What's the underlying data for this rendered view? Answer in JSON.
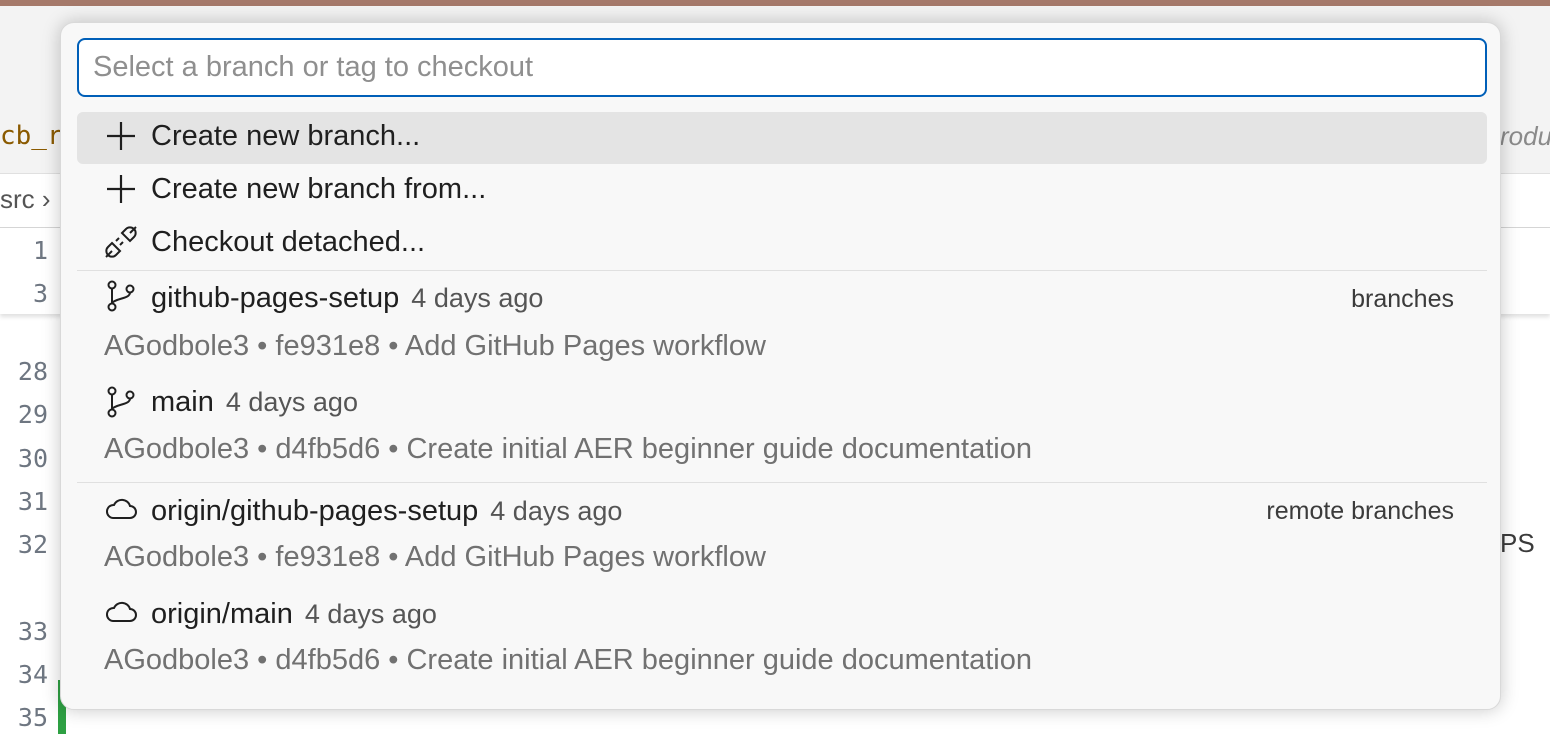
{
  "background": {
    "tab_left": "cb_r",
    "tab_right": "rodu",
    "breadcrumb": "src",
    "sticky_line_numbers": [
      "1",
      "3"
    ],
    "line_numbers": [
      "28",
      "29",
      "30",
      "31",
      "32",
      "33",
      "34",
      "35"
    ],
    "right_text": "PS"
  },
  "quickpick": {
    "placeholder": "Select a branch or tag to checkout",
    "actions": [
      {
        "icon": "plus-icon",
        "label": "Create new branch..."
      },
      {
        "icon": "plus-icon",
        "label": "Create new branch from..."
      },
      {
        "icon": "debug-disconnect-icon",
        "label": "Checkout detached..."
      }
    ],
    "branch_groups": [
      {
        "label": "branches",
        "icon": "git-branch-icon",
        "items": [
          {
            "name": "github-pages-setup",
            "time": "4 days ago",
            "detail": "AGodbole3 • fe931e8 • Add GitHub Pages workflow"
          },
          {
            "name": "main",
            "time": "4 days ago",
            "detail": "AGodbole3 • d4fb5d6 • Create initial AER beginner guide documentation"
          }
        ]
      },
      {
        "label": "remote branches",
        "icon": "cloud-icon",
        "items": [
          {
            "name": "origin/github-pages-setup",
            "time": "4 days ago",
            "detail": "AGodbole3 • fe931e8 • Add GitHub Pages workflow"
          },
          {
            "name": "origin/main",
            "time": "4 days ago",
            "detail": "AGodbole3 • d4fb5d6 • Create initial AER beginner guide documentation"
          }
        ]
      }
    ]
  },
  "colors": {
    "focus_border": "#005fb8",
    "active_row": "#e4e4e4",
    "title_strip": "#a5796a",
    "gutter_added": "#2ea043"
  }
}
